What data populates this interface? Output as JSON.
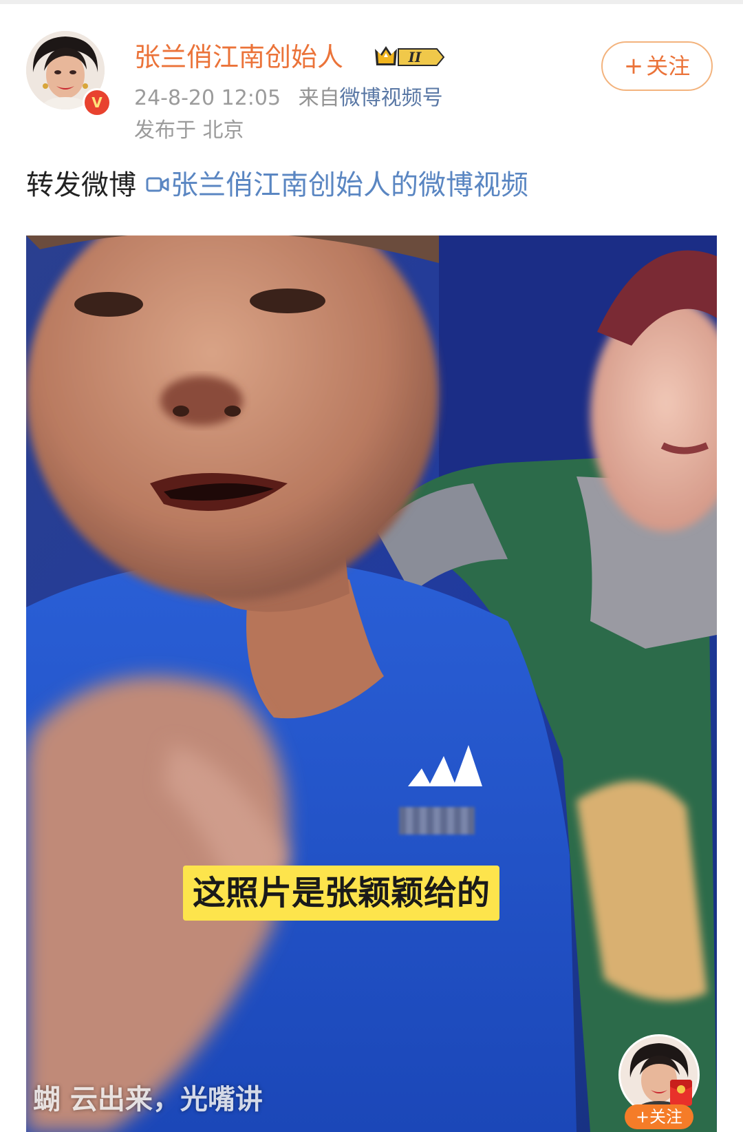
{
  "post": {
    "author": {
      "name": "张兰俏江南创始人",
      "verified_badge": "V",
      "level_badge": "II"
    },
    "meta": {
      "time": "24-8-20 12:05",
      "source_prefix": "来自",
      "source_name": "微博视频号",
      "location": "发布于 北京"
    },
    "follow_button": {
      "plus": "+",
      "label": "关注"
    },
    "text": {
      "prefix": "转发微博",
      "link": "张兰俏江南创始人的微博视频"
    }
  },
  "video": {
    "subtitle": "这照片是张颖颖给的",
    "bottom_caption": "蝴   云出来，光嘴讲",
    "mini_follow": "+关注"
  },
  "colors": {
    "name_orange": "#eb7339",
    "link_blue": "#5a86c2",
    "subtitle_yellow": "#fde44c",
    "video_blue": "#1c3f9a"
  }
}
